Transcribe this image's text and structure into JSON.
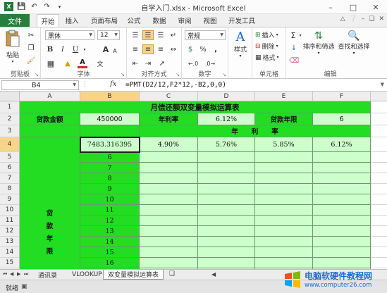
{
  "window": {
    "title": "自学入门.xlsx - Microsoft Excel"
  },
  "ribbon_tabs": [
    {
      "label": "文件"
    },
    {
      "label": "开始"
    },
    {
      "label": "插入"
    },
    {
      "label": "页面布局"
    },
    {
      "label": "公式"
    },
    {
      "label": "数据"
    },
    {
      "label": "审阅"
    },
    {
      "label": "视图"
    },
    {
      "label": "开发工具"
    }
  ],
  "ribbon": {
    "clipboard": {
      "paste": "粘贴",
      "label": "剪贴板"
    },
    "font": {
      "name": "黑体",
      "size": "12",
      "bold": "B",
      "italic": "I",
      "underline": "U",
      "color_glyph": "A",
      "label": "字体",
      "grow": "A",
      "shrink": "A"
    },
    "alignment": {
      "label": "对齐方式"
    },
    "number": {
      "format": "常规",
      "currency": "$",
      "percent": "%",
      "comma": ",",
      "label": "数字"
    },
    "styles": {
      "label": "样式",
      "glyph": "A"
    },
    "cells": {
      "insert": "插入",
      "delete": "删除",
      "format": "格式",
      "label": "单元格"
    },
    "editing": {
      "sigma": "Σ",
      "sort": "排序和筛选",
      "find": "查找和选择",
      "label": "编辑"
    }
  },
  "formula_bar": {
    "name_box": "B4",
    "fx": "fx",
    "formula": "=PMT(D2/12,F2*12,-B2,0,0)"
  },
  "columns": [
    "A",
    "B",
    "C",
    "D",
    "E",
    "F"
  ],
  "rows": [
    "1",
    "2",
    "3",
    "4",
    "5",
    "6",
    "7",
    "8",
    "9",
    "10",
    "11",
    "12",
    "13",
    "14",
    "15",
    "16"
  ],
  "sheet": {
    "title": "月偿还额双变量模拟运算表",
    "loan_amount_label": "贷款金额",
    "loan_amount_value": "450000",
    "rate_label": "年利率",
    "rate_value": "6.12%",
    "term_label": "贷款年限",
    "term_value": "6",
    "rate_header": "年　　利　　率",
    "b4_value": "7483.316395",
    "rates": [
      "4.90%",
      "5.76%",
      "5.85%",
      "6.12%"
    ],
    "years": [
      "6",
      "7",
      "8",
      "9",
      "10",
      "11",
      "12",
      "13",
      "14",
      "15",
      "16"
    ],
    "vertical_label": [
      "贷",
      "款",
      "年",
      "限"
    ]
  },
  "sheet_tabs": [
    {
      "label": "通讯录"
    },
    {
      "label": "VLOOKUP"
    },
    {
      "label": "双变量模拟运算表"
    }
  ],
  "status": {
    "text": "就绪"
  },
  "watermark": {
    "cn": "电脑软硬件教程网",
    "url": "www.computer26.com"
  },
  "colors": {
    "green_header": "#22dd22",
    "green_light": "#ccffcc",
    "file_tab": "#2a7d3c"
  }
}
